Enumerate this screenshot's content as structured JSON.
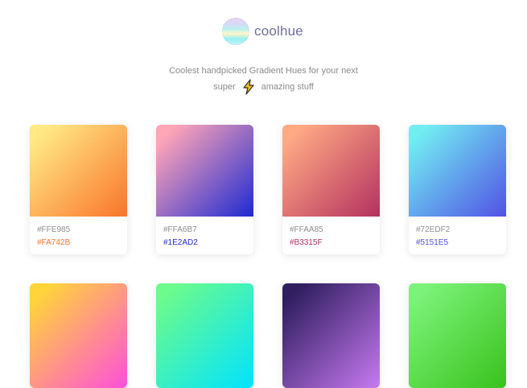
{
  "brand": {
    "name": "coolhue"
  },
  "tagline": {
    "line1": "Coolest handpicked Gradient Hues for your next",
    "line2_start": "super",
    "line2_icon": "lightning-icon",
    "line2_end": "amazing stuff"
  },
  "palettes_row1": [
    {
      "from": "#FFE985",
      "to": "#FA742B",
      "label_from": "#FFE985",
      "label_to": "#FA742B"
    },
    {
      "from": "#FFA6B7",
      "to": "#1E2AD2",
      "label_from": "#FFA6B7",
      "label_to": "#1E2AD2"
    },
    {
      "from": "#FFAA85",
      "to": "#B3315F",
      "label_from": "#FFAA85",
      "label_to": "#B3315F"
    },
    {
      "from": "#72EDF2",
      "to": "#5151E5",
      "label_from": "#72EDF2",
      "label_to": "#5151E5"
    }
  ],
  "palettes_row2": [
    {
      "from": "#FFD43B",
      "to": "#FF4FDA"
    },
    {
      "from": "#6CFB8C",
      "to": "#00E3FF"
    },
    {
      "from": "#2F1F5F",
      "to": "#C77AF0"
    },
    {
      "from": "#7CF27A",
      "to": "#39C21C"
    }
  ]
}
